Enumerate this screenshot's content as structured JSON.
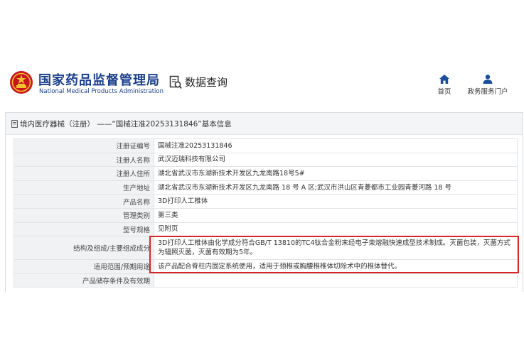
{
  "header": {
    "org_name_cn": "国家药品监督管理局",
    "org_name_en": "National Medical Products Administration",
    "query_label": "数据查询",
    "nav": [
      {
        "label": "首页",
        "icon": "home-icon"
      },
      {
        "label": "政务服务门户",
        "icon": "user-icon"
      }
    ]
  },
  "panel": {
    "title": "境内医疗器械（注册） ——“国械注准20253131846”基本信息"
  },
  "fields": [
    {
      "label": "注册证编号",
      "value": "国械注准20253131846"
    },
    {
      "label": "注册人名称",
      "value": "武汉迈瑞科技有限公司"
    },
    {
      "label": "注册人住所",
      "value": "湖北省武汉市东湖新技术开发区九龙南路18号5#"
    },
    {
      "label": "生产地址",
      "value": "湖北省武汉市东湖新技术开发区九龙南路 18 号 A 区;武汉市洪山区青菱都市工业园青菱河路 18 号"
    },
    {
      "label": "产品名称",
      "value": "3D打印人工椎体"
    },
    {
      "label": "管理类别",
      "value": "第三类"
    },
    {
      "label": "型号规格",
      "value": "见附页"
    },
    {
      "label": "结构及组成/主要组成成分",
      "value": "3D打印人工椎体由化学成分符合GB/T 13810的TC4钛合金粉末经电子束熔融快速成型技术制成。灭菌包装，灭菌方式为辐照灭菌，灭菌有效期为5年。"
    },
    {
      "label": "适用范围/预期用途",
      "value": "该产品配合脊柱内固定系统使用，适用于颈椎或胸腰椎椎体切除术中的椎体替代。"
    },
    {
      "label": "产品储存条件及有效期",
      "value": ""
    }
  ],
  "colors": {
    "brand": "#1a3f8c",
    "highlight": "#d8262a",
    "label_bg": "#f1f2f4"
  }
}
